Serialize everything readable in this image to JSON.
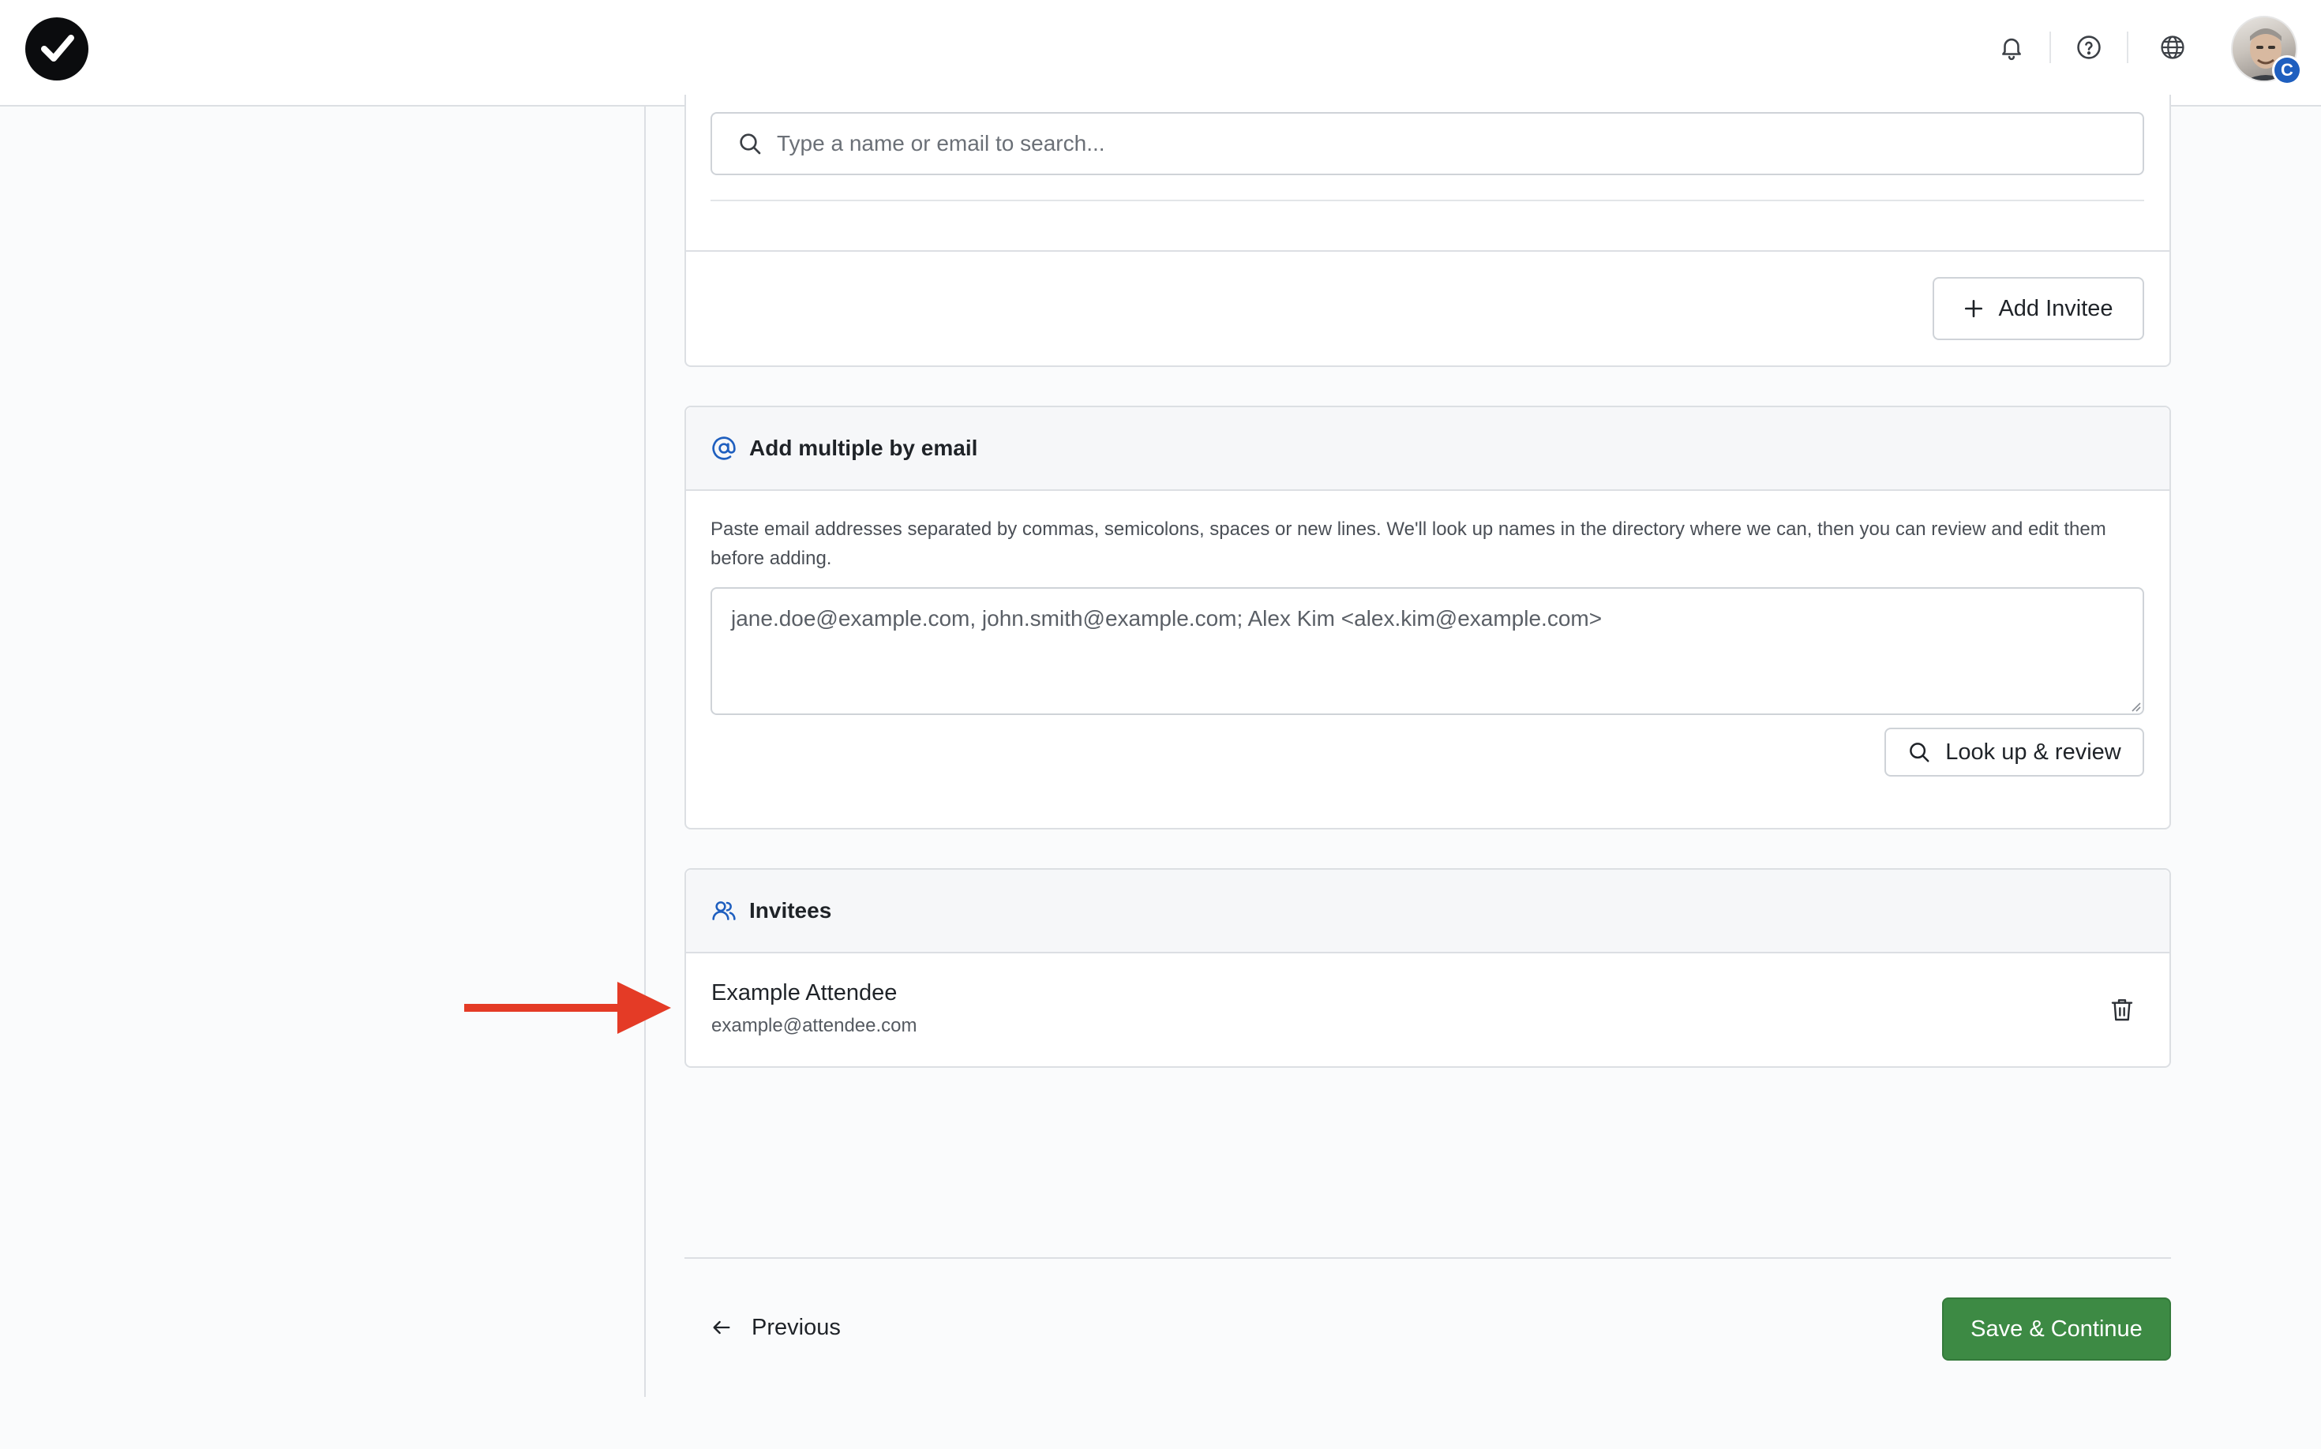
{
  "header": {
    "logo_icon": "checkmark-logo-icon",
    "icons": [
      "bell-icon",
      "help-circle-icon",
      "globe-icon"
    ],
    "avatar_badge": "C"
  },
  "search": {
    "placeholder": "Type a name or email to search..."
  },
  "add_invitee": {
    "label": "Add Invitee"
  },
  "bulk_email": {
    "title": "Add multiple by email",
    "helper": "Paste email addresses separated by commas, semicolons, spaces or new lines. We'll look up names in the directory where we can, then you can review and edit them before adding.",
    "textarea_value": "jane.doe@example.com, john.smith@example.com; Alex Kim <alex.kim@example.com>",
    "lookup_label": "Look up & review"
  },
  "invitees": {
    "title": "Invitees",
    "items": [
      {
        "name": "Example Attendee",
        "email": "example@attendee.com"
      }
    ]
  },
  "footer": {
    "previous_label": "Previous",
    "save_label": "Save & Continue"
  },
  "colors": {
    "accent_blue": "#1f5fbf",
    "save_green": "#3d8a44",
    "annotation_red": "#e43b26"
  }
}
